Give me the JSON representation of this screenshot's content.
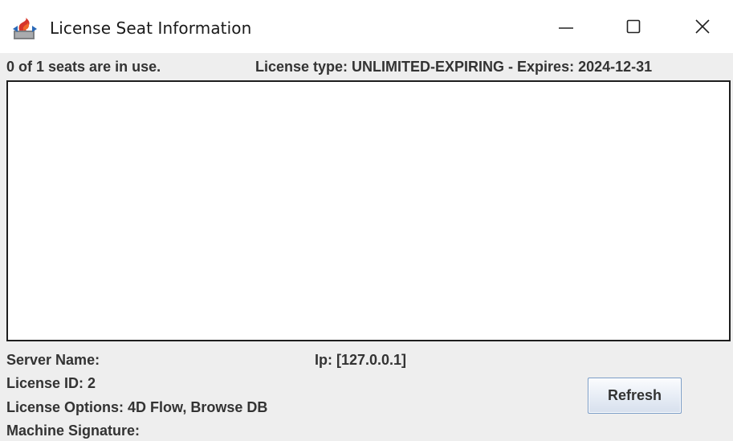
{
  "window": {
    "title": "License Seat Information",
    "icon": "java-cup-icon",
    "controls": {
      "minimize": "minimize-icon",
      "maximize": "maximize-icon",
      "close": "close-icon"
    }
  },
  "header": {
    "seats": "0 of 1 seats are in use.",
    "license_type": "License type: UNLIMITED-EXPIRING - Expires: 2024-12-31"
  },
  "seat_list": {
    "items": []
  },
  "footer": {
    "server_name": "Server Name:",
    "ip": "Ip: [127.0.0.1]",
    "license_id": "License ID: 2",
    "license_options": "License Options: 4D Flow, Browse DB",
    "machine_signature": "Machine Signature:",
    "refresh_label": "Refresh"
  },
  "colors": {
    "window_bg": "#eeeeee",
    "titlebar_bg": "#ffffff",
    "text": "#333333",
    "list_border": "#1e1e1e",
    "button_border": "#7a9cc6"
  }
}
